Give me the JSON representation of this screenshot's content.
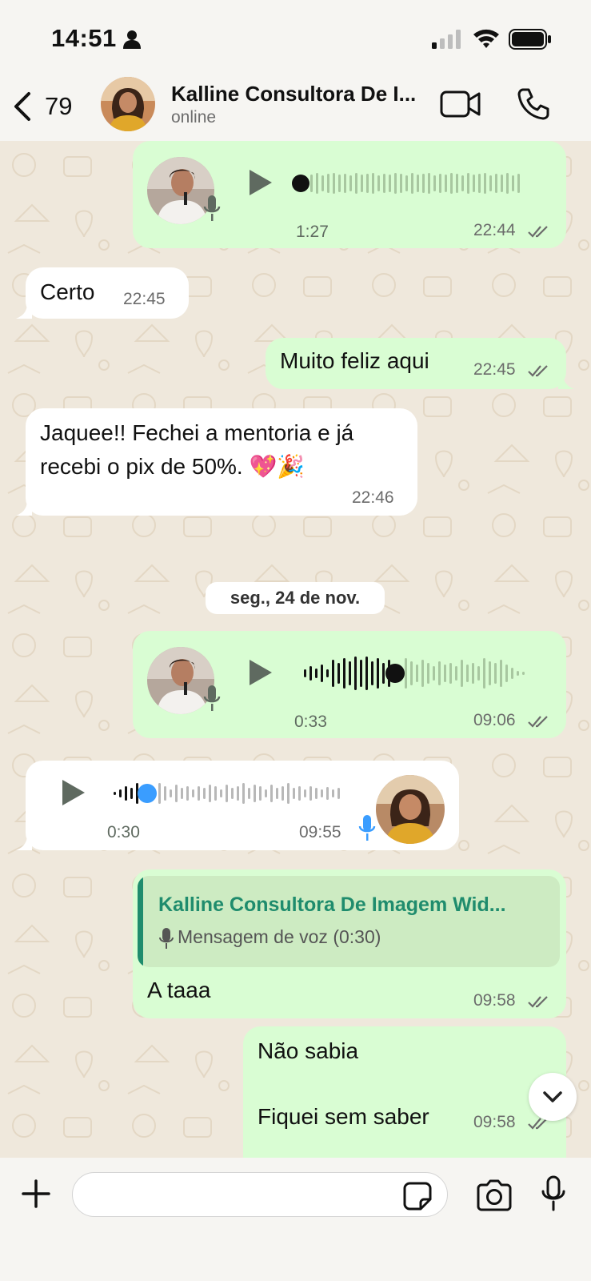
{
  "status_bar": {
    "time": "14:51"
  },
  "header": {
    "back_count": "79",
    "contact_name": "Kalline Consultora De I...",
    "contact_status": "online"
  },
  "messages": {
    "m1": {
      "type": "voice",
      "direction": "outgoing",
      "duration": "1:27",
      "time": "22:44",
      "progress": 0.0
    },
    "m2": {
      "type": "text",
      "direction": "incoming",
      "text": "Certo",
      "time": "22:45"
    },
    "m3": {
      "type": "text",
      "direction": "outgoing",
      "text": "Muito feliz aqui",
      "time": "22:45"
    },
    "m4": {
      "type": "text",
      "direction": "incoming",
      "line1": "Jaquee!! Fechei a mentoria e já",
      "line2": "recebi o pix de 50%. 💖🎉",
      "time": "22:46"
    },
    "date_separator": "seg., 24 de nov.",
    "m5": {
      "type": "voice",
      "direction": "outgoing",
      "duration": "0:33",
      "time": "09:06",
      "progress": 0.38
    },
    "m6": {
      "type": "voice",
      "direction": "incoming",
      "duration": "0:30",
      "time": "09:55",
      "progress": 0.14
    },
    "m7": {
      "type": "reply",
      "direction": "outgoing",
      "quote_author": "Kalline Consultora De Imagem Wid...",
      "quote_text": "Mensagem de voz (0:30)",
      "text": "A taaa",
      "time": "09:58"
    },
    "m8": {
      "type": "text",
      "direction": "outgoing",
      "line1": "Não sabia",
      "line2": "Fiquei sem saber",
      "time": "09:58"
    }
  },
  "composer": {
    "placeholder": ""
  },
  "colors": {
    "outgoing_bubble": "#d9fdd3",
    "incoming_bubble": "#ffffff",
    "accent_green": "#1f8c6d",
    "read_ticks": "#6b6b6b",
    "voice_played": "#3a9dff"
  },
  "icons": [
    "person-icon",
    "signal-icon",
    "wifi-icon",
    "battery-icon",
    "back-chevron-icon",
    "video-call-icon",
    "phone-icon",
    "play-icon",
    "mic-icon",
    "double-check-icon",
    "chevron-down-icon",
    "plus-icon",
    "sticker-icon",
    "camera-icon"
  ]
}
